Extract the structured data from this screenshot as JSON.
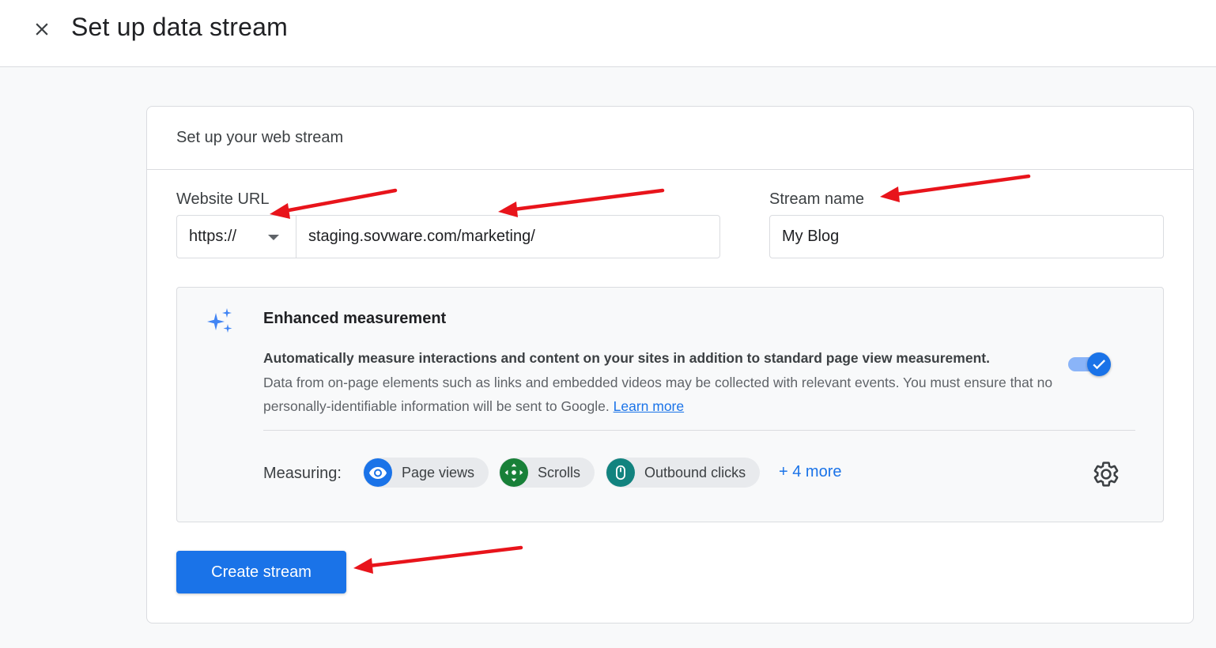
{
  "header": {
    "title": "Set up data stream",
    "close_icon": "close-icon"
  },
  "card": {
    "title": "Set up your web stream",
    "website_url_label": "Website URL",
    "protocol_value": "https://",
    "url_value": "staging.sovware.com/marketing/",
    "stream_name_label": "Stream name",
    "stream_name_value": "My Blog"
  },
  "enhanced": {
    "title": "Enhanced measurement",
    "desc_bold": "Automatically measure interactions and content on your sites in addition to standard page view measurement.",
    "desc": "Data from on-page elements such as links and embedded videos may be collected with relevant events. You must ensure that no personally-identifiable information will be sent to Google.",
    "learn_more": "Learn more",
    "toggle_on": true,
    "measuring_label": "Measuring:",
    "chips": [
      {
        "label": "Page views",
        "icon": "eye-icon",
        "color": "#1a73e8"
      },
      {
        "label": "Scrolls",
        "icon": "scroll-arrows-icon",
        "color": "#188038"
      },
      {
        "label": "Outbound clicks",
        "icon": "mouse-icon",
        "color": "#12837f"
      }
    ],
    "more": "+ 4 more",
    "settings_icon": "gear-icon"
  },
  "actions": {
    "create_label": "Create stream"
  },
  "colors": {
    "primary": "#1a73e8",
    "annotation_arrow": "#e8141b"
  }
}
